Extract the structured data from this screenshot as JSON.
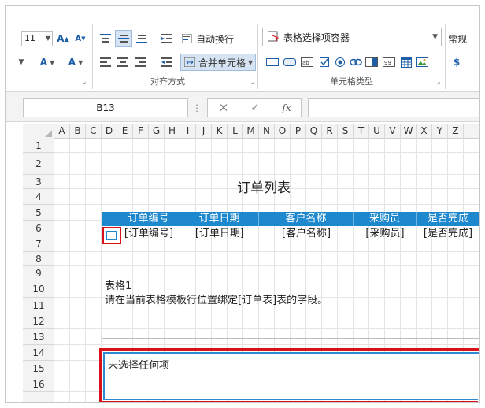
{
  "ribbon": {
    "font_size": "11",
    "font_grow": "A",
    "font_shrink": "A",
    "font_color": "A",
    "font_color2": "A",
    "wrap_text": "自动换行",
    "merge_cells": "合并单元格",
    "align_group": "对齐方式",
    "cell_type_group": "单元格类型",
    "cell_type_selector": "表格选择项容器",
    "number_format": "常规",
    "currency": "$"
  },
  "formula_bar": {
    "name_box": "B13",
    "fx": "fx"
  },
  "sheet": {
    "columns": [
      "A",
      "B",
      "C",
      "D",
      "E",
      "F",
      "G",
      "H",
      "I",
      "J",
      "K",
      "L",
      "M",
      "N",
      "O",
      "P",
      "Q",
      "R",
      "S",
      "T",
      "U",
      "V",
      "W",
      "X",
      "Y",
      "Z"
    ],
    "rows": [
      "1",
      "2",
      "3",
      "4",
      "5",
      "6",
      "7",
      "8",
      "9",
      "10",
      "11",
      "12",
      "13",
      "14",
      "15",
      "16"
    ],
    "title": "订单列表",
    "headers": [
      "订单编号",
      "订单日期",
      "客户名称",
      "采购员",
      "是否完成"
    ],
    "fields": [
      "[订单编号]",
      "[订单日期]",
      "[客户名称]",
      "[采购员]",
      "[是否完成]"
    ],
    "note_title": "表格1",
    "note_body": "请在当前表格模板行位置绑定[订单表]表的字段。",
    "selection_text": "未选择任何项"
  },
  "colors": {
    "accent": "#1e88cf",
    "highlight": "#d9121a"
  }
}
